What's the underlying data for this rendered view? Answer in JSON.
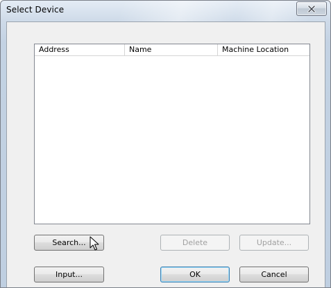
{
  "window": {
    "title": "Select Device"
  },
  "list": {
    "columns": [
      "Address",
      "Name",
      "Machine Location"
    ],
    "rows": []
  },
  "buttons": {
    "search": "Search...",
    "delete": "Delete",
    "update": "Update...",
    "input": "Input...",
    "ok": "OK",
    "cancel": "Cancel"
  },
  "icons": {
    "close": "close-icon",
    "cursor": "mouse-pointer-icon"
  }
}
